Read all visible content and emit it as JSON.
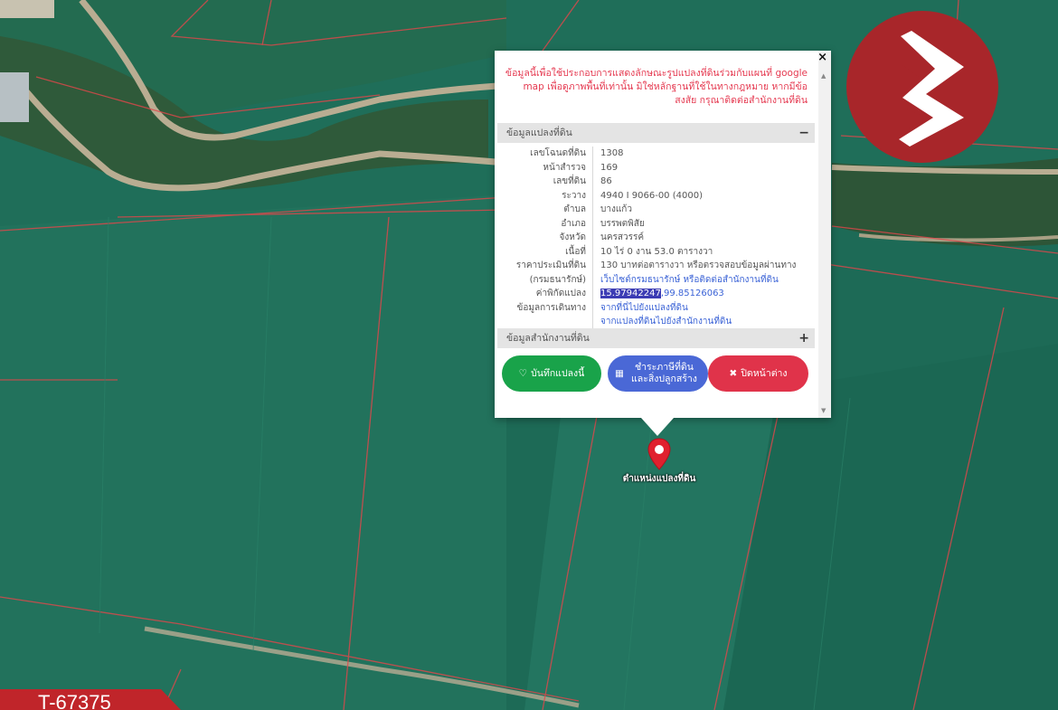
{
  "map": {
    "marker_label": "ตำแหน่งแปลงที่ดิน"
  },
  "popup": {
    "close_symbol": "×",
    "notice": "ข้อมูลนี้เพื่อใช้ประกอบการแสดงลักษณะรูปแปลงที่ดินร่วมกับแผนที่ google map เพื่อดูภาพพื้นที่เท่านั้น มิใช่หลักฐานที่ใช้ในทางกฎหมาย หากมีข้อสงสัย กรุณาติดต่อสำนักงานที่ดิน",
    "section_land": {
      "title": "ข้อมูลแปลงที่ดิน",
      "toggle": "−"
    },
    "section_office": {
      "title": "ข้อมูลสำนักงานที่ดิน",
      "toggle": "+"
    },
    "rows": [
      {
        "label": "เลขโฉนดที่ดิน",
        "value": "1308"
      },
      {
        "label": "หน้าสำรวจ",
        "value": "169"
      },
      {
        "label": "เลขที่ดิน",
        "value": "86"
      },
      {
        "label": "ระวาง",
        "value": "4940 I 9066-00 (4000)"
      },
      {
        "label": "ตำบล",
        "value": "บางแก้ว"
      },
      {
        "label": "อำเภอ",
        "value": "บรรพตพิสัย"
      },
      {
        "label": "จังหวัด",
        "value": "นครสวรรค์"
      },
      {
        "label": "เนื้อที่",
        "value": "10 ไร่ 0 งาน 53.0 ตารางวา"
      },
      {
        "label": "ราคาประเมินที่ดิน",
        "value": "130 บาทต่อตารางวา หรือตรวจสอบข้อมูลผ่านทาง"
      },
      {
        "label": "(กรมธนารักษ์)",
        "value": "เว็บไซต์กรมธนารักษ์ หรือติดต่อสำนักงานที่ดิน"
      },
      {
        "label": "ค่าพิกัดแปลง",
        "value_highlight": "15.97942247",
        "value_rest": ",99.85126063"
      },
      {
        "label": "ข้อมูลการเดินทาง",
        "value": "จากที่นี่ไปยังแปลงที่ดิน"
      },
      {
        "label": "",
        "value": "จากแปลงที่ดินไปยังสำนักงานที่ดิน"
      }
    ],
    "buttons": {
      "save": {
        "icon": "♡",
        "label": "บันทึกแปลงนี้"
      },
      "pay": {
        "icon": "▦",
        "label": "ชำระภาษีที่ดินและสิ่งปลูกสร้าง"
      },
      "close": {
        "icon": "✖",
        "label": "ปิดหน้าต่าง"
      }
    },
    "scroll_up": "▲",
    "scroll_down": "▼"
  },
  "listing": {
    "code": "T-67375"
  },
  "colors": {
    "field": "#1f6e59",
    "notice_red": "#e53950",
    "btn_green": "#19a34a",
    "btn_blue": "#4a68d6",
    "btn_red": "#e0334a",
    "logo_red": "#a8262a",
    "marker": "#e0202e"
  }
}
